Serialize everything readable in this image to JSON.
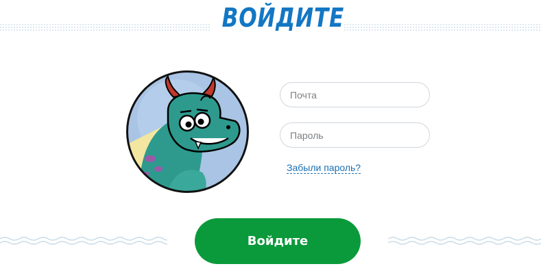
{
  "header": {
    "title": "ВОЙДИТЕ"
  },
  "form": {
    "email_placeholder": "Почта",
    "password_placeholder": "Пароль",
    "forgot_label": "Забыли пароль?",
    "submit_label": "Войдите"
  },
  "icons": {
    "avatar": "dragon-avatar-icon"
  },
  "colors": {
    "title": "#1377c4",
    "button": "#0a9a3b",
    "link": "#1a6fb3",
    "decor": "#c8dce8"
  }
}
